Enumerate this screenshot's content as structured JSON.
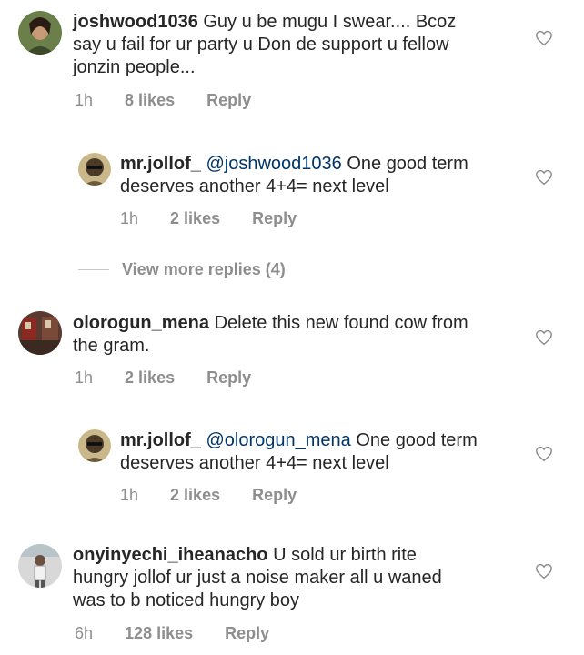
{
  "comments": [
    {
      "username": "joshwood1036",
      "mention": "",
      "text": "Guy u be mugu I swear.... Bcoz say u fail for ur party u Don de support u fellow jonzin people...",
      "time": "1h",
      "likes": "8 likes",
      "reply": "Reply",
      "replies": [
        {
          "username": "mr.jollof_",
          "mention": "@joshwood1036",
          "text": "One good term deserves another 4+4= next level",
          "time": "1h",
          "likes": "2 likes",
          "reply": "Reply"
        }
      ],
      "view_more": "View more replies (4)"
    },
    {
      "username": "olorogun_mena",
      "mention": "",
      "text": "Delete this new found cow from the gram.",
      "time": "1h",
      "likes": "2 likes",
      "reply": "Reply",
      "replies": [
        {
          "username": "mr.jollof_",
          "mention": "@olorogun_mena",
          "text": "One good term deserves another 4+4= next level",
          "time": "1h",
          "likes": "2 likes",
          "reply": "Reply"
        }
      ]
    },
    {
      "username": "onyinyechi_iheanacho",
      "mention": "",
      "text": "U sold ur birth rite hungry jollof ur just a noise maker all u waned was to b noticed hungry boy",
      "time": "6h",
      "likes": "128 likes",
      "reply": "Reply",
      "replies": []
    }
  ],
  "icons": {
    "like": "heart-outline-icon"
  },
  "colors": {
    "text": "#262626",
    "meta": "#8e8e8e",
    "mention": "#003569"
  }
}
